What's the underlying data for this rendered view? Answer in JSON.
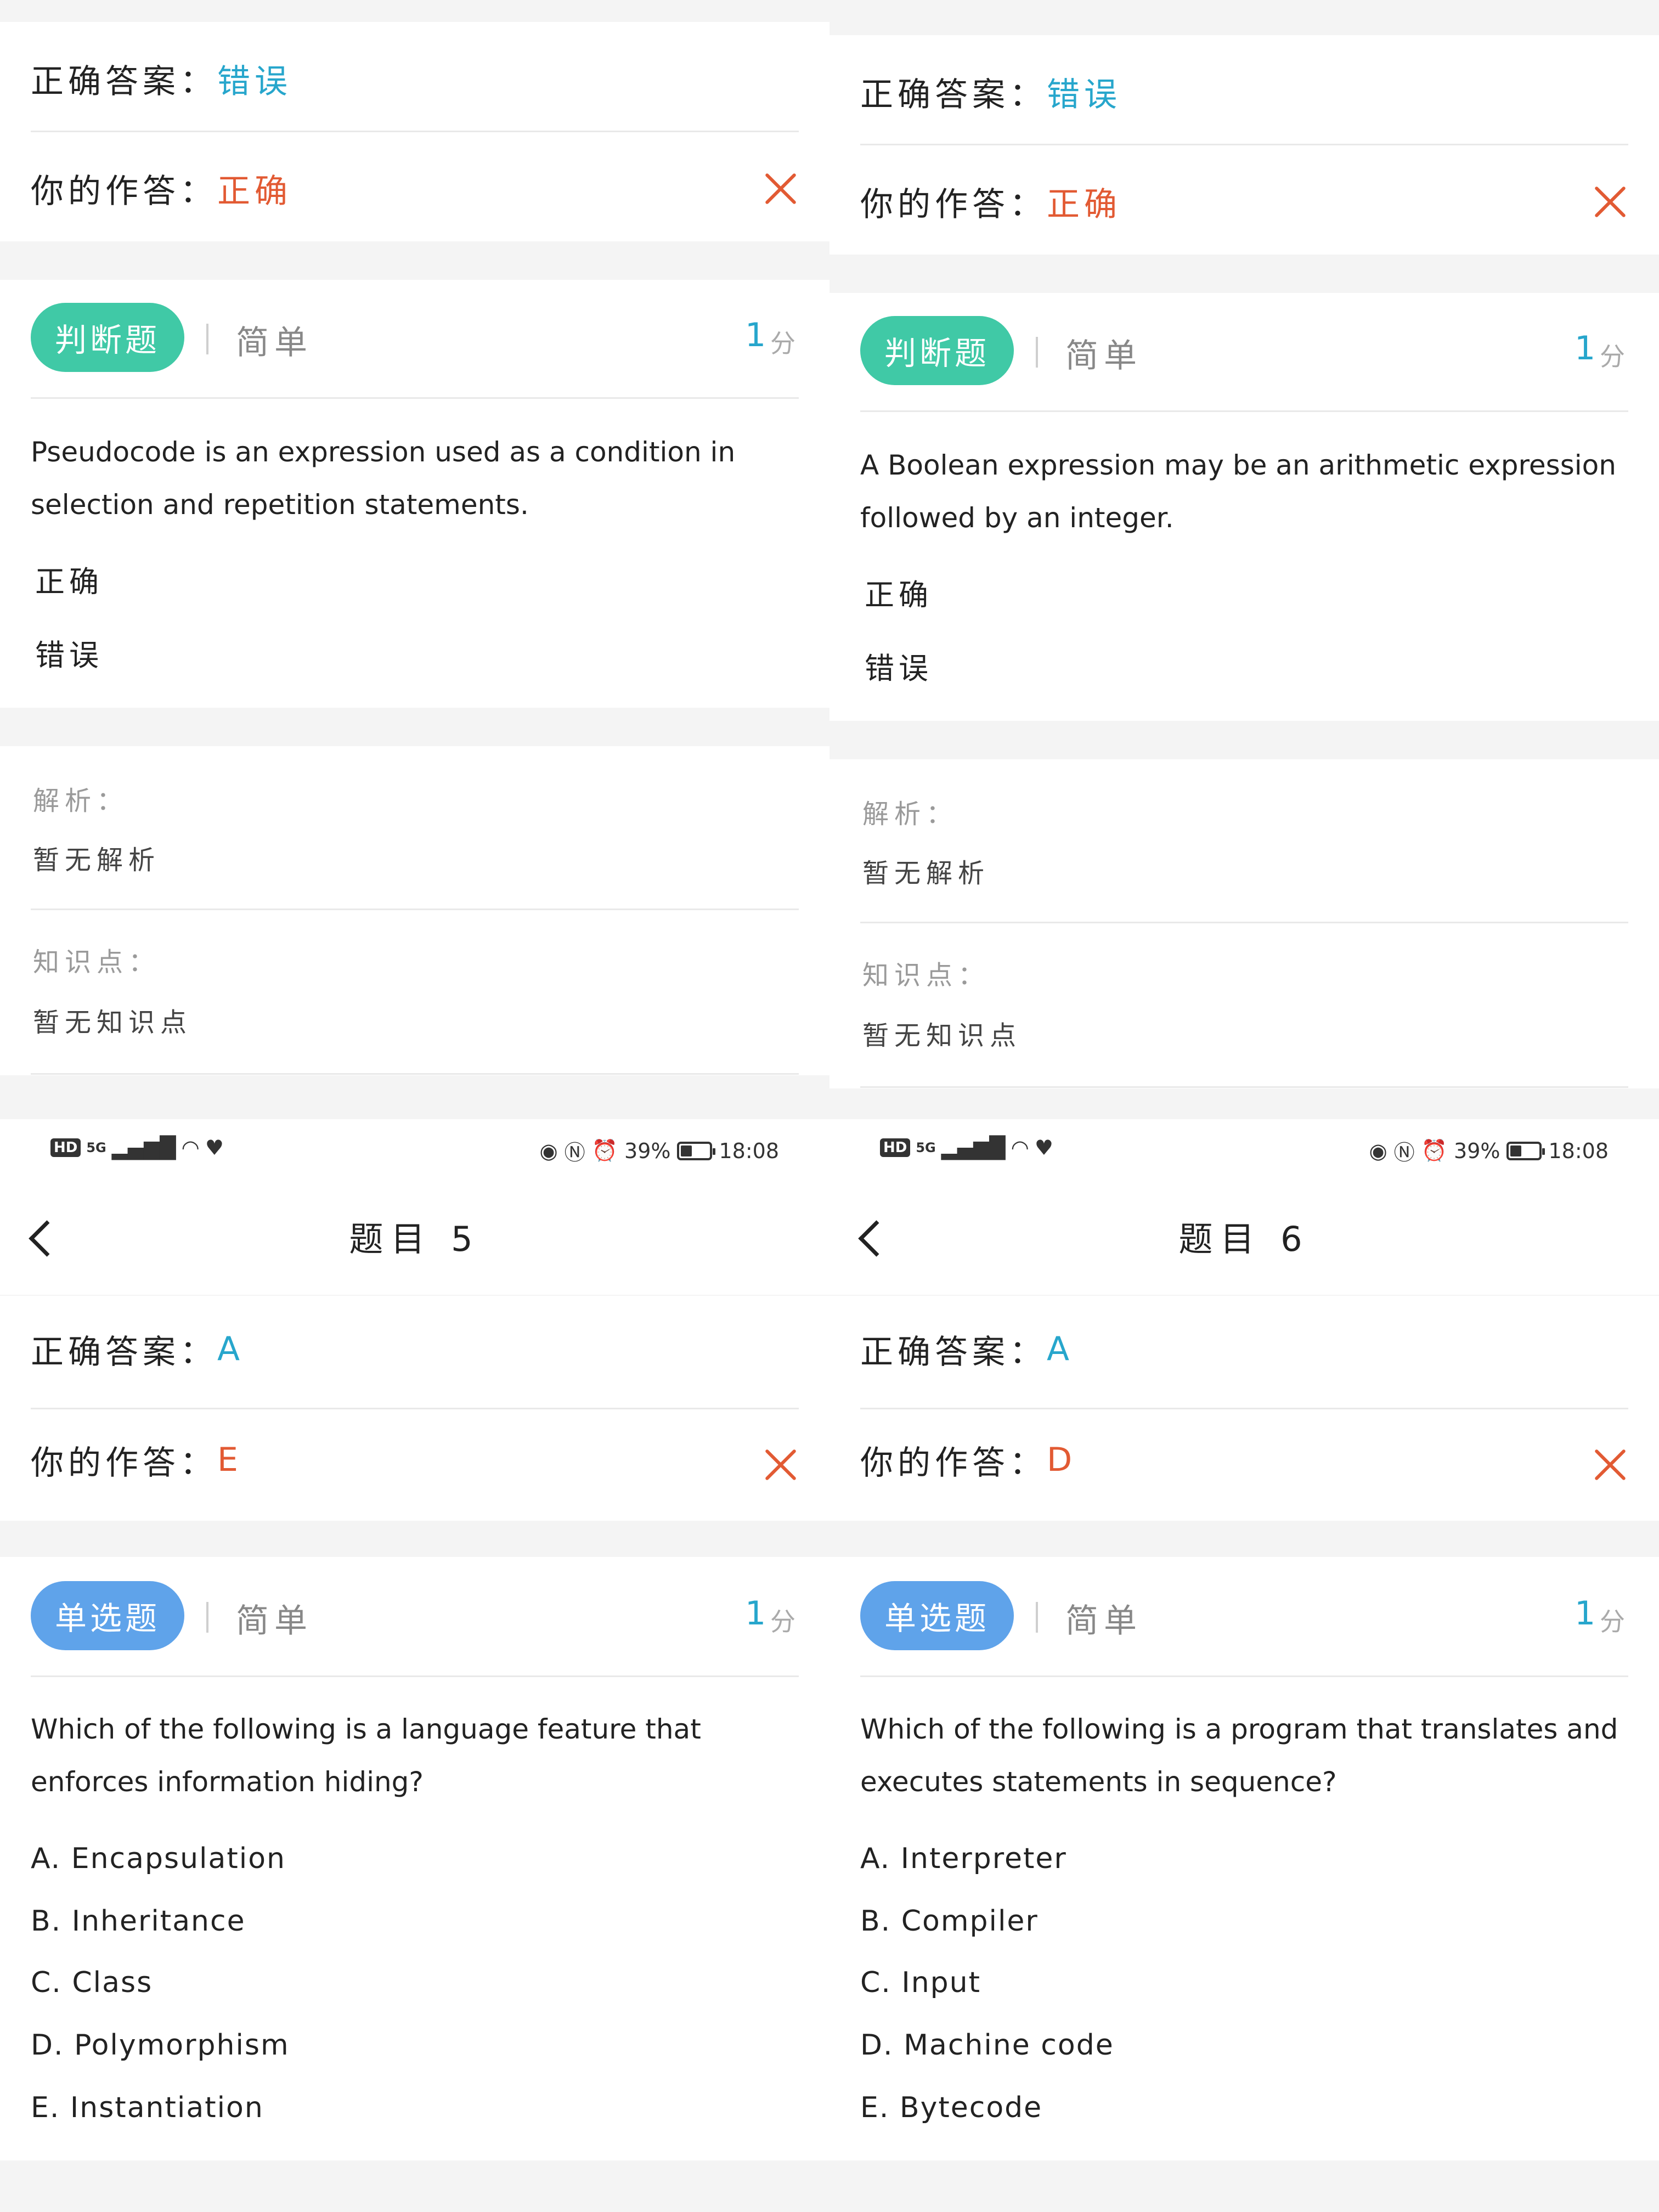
{
  "labels": {
    "correct_answer": "正确答案：",
    "your_answer": "你的作答：",
    "score_unit": "分",
    "analysis": "解析：",
    "analysis_value": "暂无解析",
    "knowledge": "知识点：",
    "knowledge_value": "暂无知识点",
    "true_opt": "正确",
    "false_opt": "错误"
  },
  "status_bar": {
    "hd": "HD",
    "signal": "5G",
    "battery": "39%",
    "battery_level": 0.39,
    "time": "18:08"
  },
  "left": {
    "q_top": {
      "correct": "错误",
      "yours": "正确",
      "type": "判断题",
      "difficulty": "简单",
      "score": "1",
      "question": "Pseudocode is an expression used as a condition in selection and repetition statements."
    },
    "q_bottom": {
      "title": "题目 5",
      "correct": "A",
      "yours": "E",
      "type": "单选题",
      "difficulty": "简单",
      "score": "1",
      "question": "Which of the following is a language feature that enforces information hiding?",
      "options": [
        "A. Encapsulation",
        "B. Inheritance",
        "C. Class",
        "D. Polymorphism",
        "E. Instantiation"
      ]
    }
  },
  "right": {
    "q_top": {
      "correct": "错误",
      "yours": "正确",
      "type": "判断题",
      "difficulty": "简单",
      "score": "1",
      "question": "A Boolean expression may be an arithmetic expression followed by an integer."
    },
    "q_bottom": {
      "title": "题目 6",
      "correct": "A",
      "yours": "D",
      "type": "单选题",
      "difficulty": "简单",
      "score": "1",
      "question": "Which of the following is a program that translates and executes statements in sequence?",
      "options": [
        "A. Interpreter",
        "B. Compiler",
        "C. Input",
        "D. Machine code",
        "E. Bytecode"
      ]
    }
  }
}
